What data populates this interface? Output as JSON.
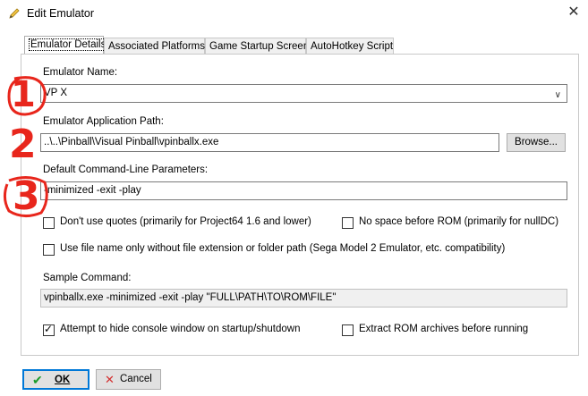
{
  "window": {
    "title": "Edit Emulator"
  },
  "tabs": [
    "Emulator Details",
    "Associated Platforms",
    "Game Startup Screen",
    "AutoHotkey Script"
  ],
  "fields": {
    "emulator_name": {
      "label": "Emulator Name:",
      "value": "VP X"
    },
    "app_path": {
      "label": "Emulator Application Path:",
      "value": "..\\..\\Pinball\\Visual Pinball\\vpinballx.exe",
      "browse_label": "Browse..."
    },
    "params": {
      "label": "Default Command-Line Parameters:",
      "value": "-minimized -exit -play"
    },
    "sample": {
      "label": "Sample Command:",
      "value": "vpinballx.exe -minimized -exit -play \"FULL\\PATH\\TO\\ROM\\FILE\""
    }
  },
  "checkboxes": {
    "dont_use_quotes": {
      "label": "Don't use quotes (primarily for Project64 1.6 and lower)",
      "checked": false
    },
    "no_space": {
      "label": "No space before ROM (primarily for nullDC)",
      "checked": false
    },
    "file_name_only": {
      "label": "Use file name only without file extension or folder path (Sega Model 2 Emulator, etc. compatibility)",
      "checked": false
    },
    "hide_console": {
      "label": "Attempt to hide console window on startup/shutdown",
      "checked": true
    },
    "extract_rom": {
      "label": "Extract ROM archives before running",
      "checked": false
    }
  },
  "annotations": [
    "1",
    "2",
    "3"
  ],
  "buttons": {
    "ok": "OK",
    "cancel": "Cancel"
  },
  "colors": {
    "annotation": "#e8261c",
    "ok_check": "#1a9c2a",
    "cancel_x": "#d32f2f",
    "focus": "#0078d7"
  }
}
